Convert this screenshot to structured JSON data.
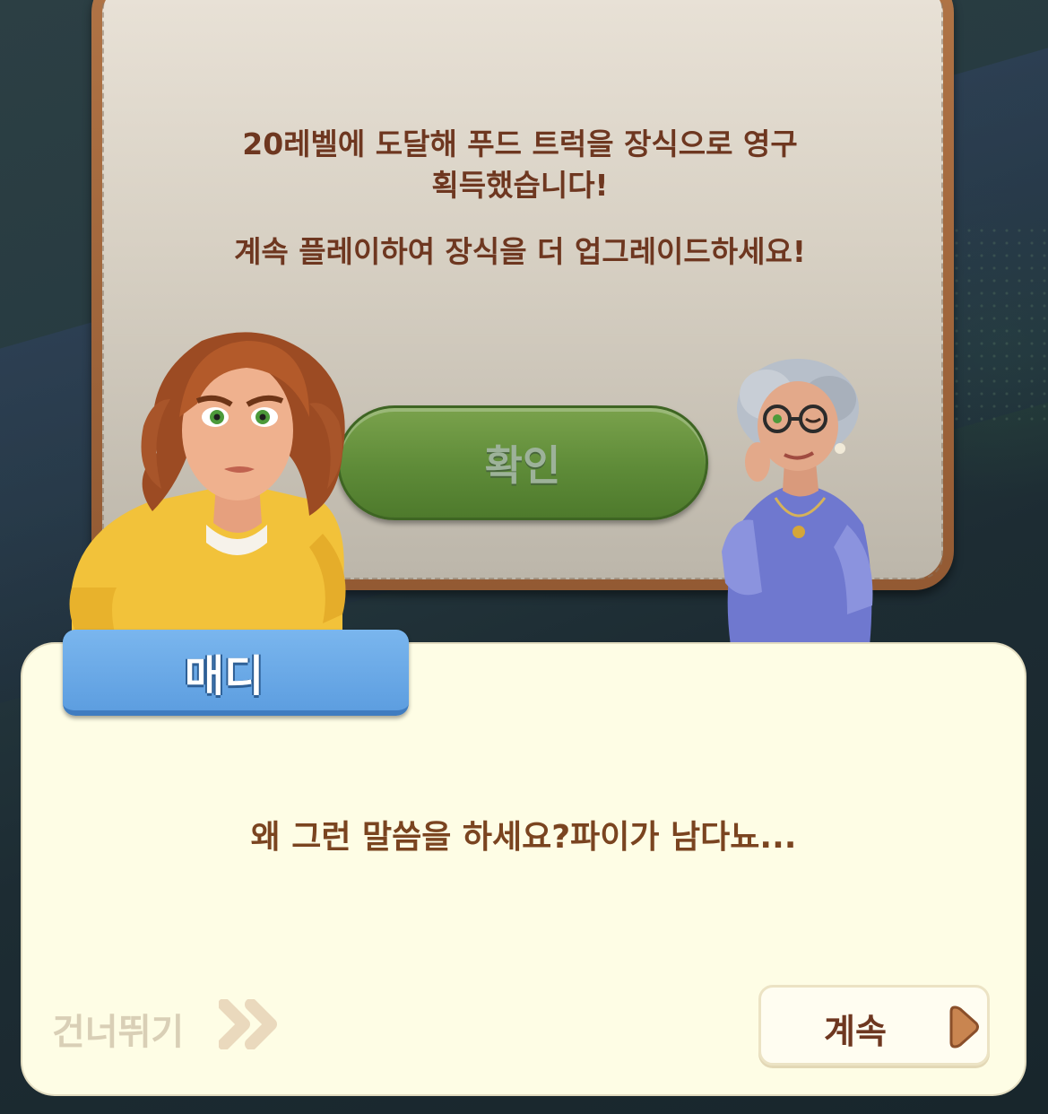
{
  "modal": {
    "message_line1": "20레벨에 도달해 푸드 트럭을 장식으로 영구",
    "message_line2": "획득했습니다!",
    "message_line3": "계속 플레이하여 장식을 더 업그레이드하세요!",
    "confirm_label": "확인"
  },
  "dialog": {
    "speaker_name": "매디",
    "text": "왜 그런 말씀을 하세요?파이가 남다뇨...",
    "skip_label": "건너뛰기",
    "continue_label": "계속"
  },
  "icons": {
    "skip": "double-chevron-right-icon",
    "continue": "play-triangle-icon"
  },
  "colors": {
    "modal_text": "#6e3720",
    "confirm_button": "#5e8b38",
    "nameplate": "#5d9ee0",
    "dialog_bg": "#fefde5",
    "dialog_text": "#7a4420",
    "skip_text": "#d9cfb6"
  }
}
